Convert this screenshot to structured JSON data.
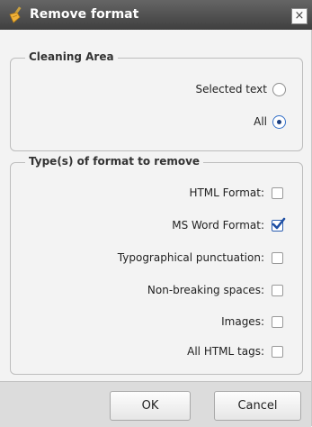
{
  "dialog": {
    "title": "Remove format",
    "close_label": "×",
    "icon": "broom-icon"
  },
  "cleaning_area": {
    "legend": "Cleaning Area",
    "options": [
      {
        "label": "Selected text",
        "checked": false
      },
      {
        "label": "All",
        "checked": true
      }
    ]
  },
  "format_types": {
    "legend": "Type(s) of format to remove",
    "options": [
      {
        "label": "HTML Format:",
        "checked": false
      },
      {
        "label": "MS Word Format:",
        "checked": true
      },
      {
        "label": "Typographical punctuation:",
        "checked": false
      },
      {
        "label": "Non-breaking spaces:",
        "checked": false
      },
      {
        "label": "Images:",
        "checked": false
      },
      {
        "label": "All HTML tags:",
        "checked": false
      }
    ]
  },
  "footer": {
    "ok_label": "OK",
    "cancel_label": "Cancel"
  },
  "colors": {
    "titlebar": "#4a4a4a",
    "accent": "#2a5db0"
  }
}
